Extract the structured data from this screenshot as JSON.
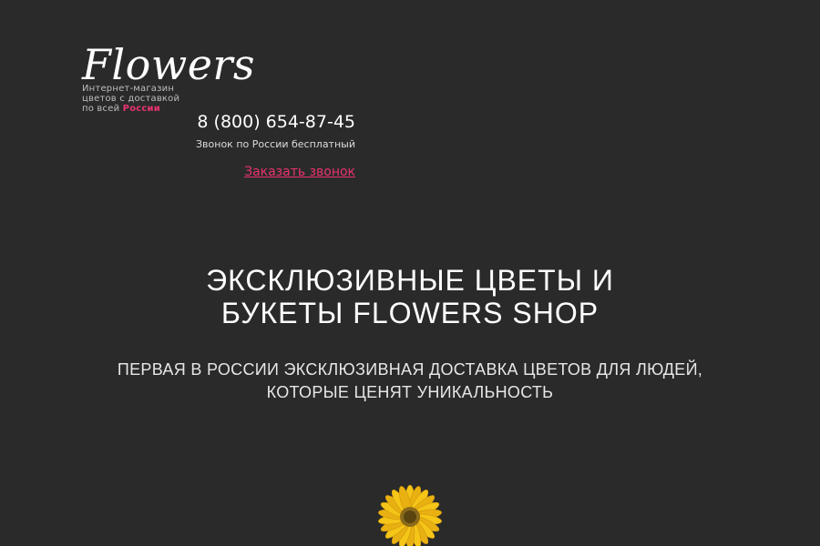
{
  "header": {
    "logo_text": "Flowers",
    "tagline_line1": "Интернет-магазин",
    "tagline_line2": "цветов с доставкой",
    "tagline_prefix": "по всей",
    "tagline_highlight": "России",
    "phone": "8 (800) 654-87-45",
    "phone_note": "Звонок по России бесплатный",
    "callback_link": "Заказать звонок"
  },
  "hero": {
    "title_line1": "ЭКСКЛЮЗИВНЫЕ ЦВЕТЫ И",
    "title_line2": "БУКЕТЫ FLOWERS SHOP",
    "subtitle_line1": "ПЕРВАЯ В РОССИИ ЭКСКЛЮЗИВНАЯ ДОСТАВКА ЦВЕТОВ ДЛЯ ЛЮДЕЙ,",
    "subtitle_line2": "КОТОРЫЕ ЦЕНЯТ УНИКАЛЬНОСТЬ",
    "image": "yellow-gerbera-flower"
  },
  "colors": {
    "background": "#2a2a2a",
    "accent": "#e8336d",
    "text": "#ffffff",
    "flower_petals": "#f5c518",
    "flower_center": "#8a6a1a"
  }
}
